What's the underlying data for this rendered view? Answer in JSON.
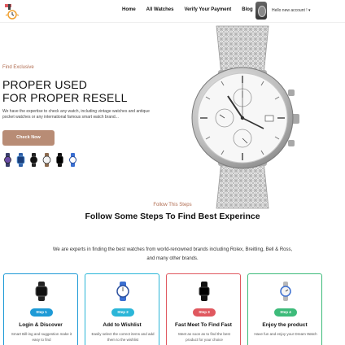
{
  "header": {
    "nav": [
      "Home",
      "All Watches",
      "Verify Your Payment",
      "Blog"
    ],
    "account": "Hello new account ! ▾"
  },
  "hero": {
    "eyebrow": "Find Exclusive",
    "title_line1": "PROPER USED",
    "title_line2": "FOR PROPER RESELL",
    "description": "We have the expertise to check any watch, including vintage watches and antique pocket watches or any international famous smart watch brand...",
    "cta": "Check Now",
    "thumbnails": [
      "watch-purple",
      "watch-smart-blue",
      "watch-black-dial",
      "watch-white-dial",
      "watch-black-smart",
      "watch-blue-sport"
    ]
  },
  "steps": {
    "eyebrow": "Follow This Steps",
    "title": "Follow Some Steps To Find Best Experince",
    "description": "We are experts in finding the best watches from world-renowned brands including Rolex, Breitling, Bell & Ross, and many other brands.",
    "cards": [
      {
        "badge": "Step 1",
        "title": "Login & Discover",
        "desc": "Smart Bill-ing and suggestion make it easy to find",
        "color": "#1e9ad6"
      },
      {
        "badge": "Step 2",
        "title": "Add to Wishlist",
        "desc": "Easily select the correct items and add them to the wishlist",
        "color": "#2bb6d8"
      },
      {
        "badge": "Step 3",
        "title": "Fast Meet To Find Fast",
        "desc": "Meet as soon as to find the best product for your choice",
        "color": "#e0585f"
      },
      {
        "badge": "Step 4",
        "title": "Enjoy the product",
        "desc": "Have fun and enjoy your Dream Watch",
        "color": "#3dbb7a"
      }
    ]
  },
  "colors": {
    "accent": "#b06b4f",
    "cta": "#b88c75"
  }
}
